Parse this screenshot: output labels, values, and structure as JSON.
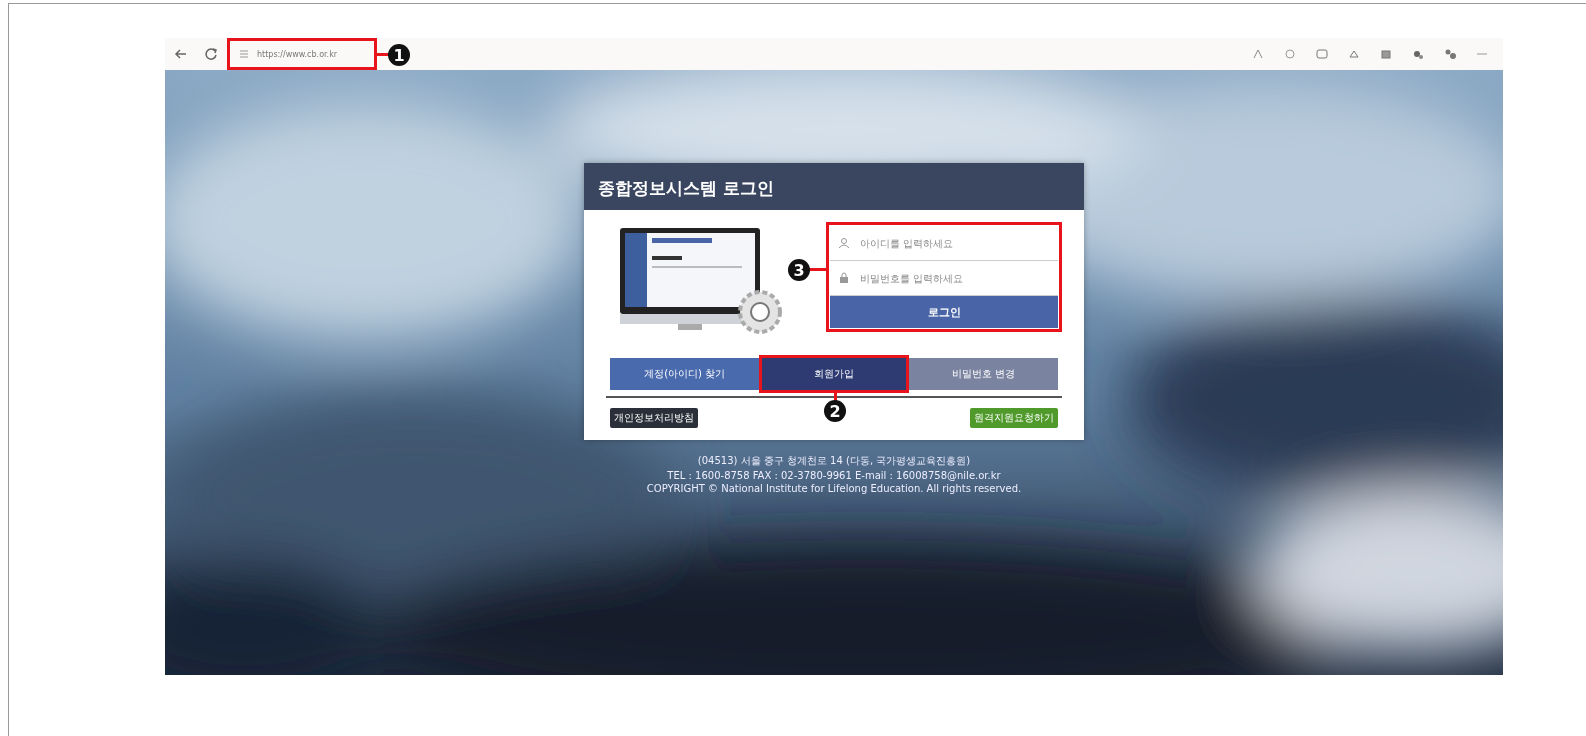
{
  "browser": {
    "url": "https://www.cb.or.kr",
    "callout": "1"
  },
  "login": {
    "title": "종합정보시스템 로그인",
    "id_placeholder": "아이디를 입력하세요",
    "pw_placeholder": "비밀번호를 입력하세요",
    "login_button": "로그인",
    "callout": "3"
  },
  "buttons": [
    {
      "label": "계정(아이디) 찾기",
      "color": "#4a6aae"
    },
    {
      "label": "회원가입",
      "color": "#2e3b73",
      "callout": "2"
    },
    {
      "label": "비밀번호 변경",
      "color": "#7a83a0"
    }
  ],
  "links": [
    {
      "label": "개인정보처리방침",
      "kind": "dark"
    },
    {
      "label": "원격지원요청하기",
      "kind": "green"
    }
  ],
  "footer": [
    "(04513) 서울 중구 청계천로 14 (다동, 국가평생교육진흥원)",
    "TEL : 1600-8758  FAX : 02-3780-9961  E-mail : 16008758@nile.or.kr",
    "COPYRIGHT © National Institute for Lifelong Education. All rights reserved."
  ]
}
